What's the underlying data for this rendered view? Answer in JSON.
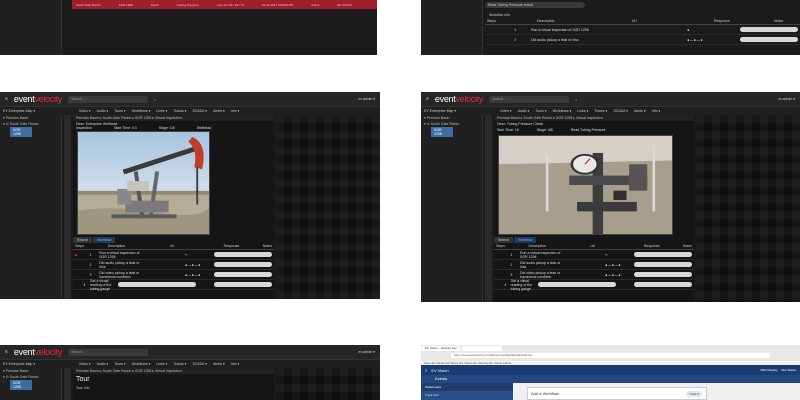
{
  "colors": {
    "brand_red": "#e8293a",
    "accent_blue": "#7ab3ff",
    "sidebar_active": "#3b6ea5",
    "table_red": "#a11e2c",
    "wv_blue": "#1a3b73"
  },
  "app": {
    "logo_event": "event",
    "logo_velocity": "velocity",
    "search": "Search...",
    "user": "ev.admin ▾"
  },
  "menu": {
    "label": "EV Enterprise Map ▾",
    "items": [
      "Video ▾",
      "Audio ▾",
      "Tours ▾",
      "Workflows ▾",
      "Links ▾",
      "Tracks ▾",
      "SCADA ▾",
      "Alerts ▾",
      "Info ▾"
    ]
  },
  "sidebar": {
    "items": [
      "▾ Permian Basin",
      "▾ ⊙ South Gate Ranch",
      "SGR 1298"
    ]
  },
  "crumb": "Permian Basin ▸ South Gate Ranch ▸ SGR 1298 ▸ Virtual Inspection",
  "p1": {
    "h1": "Desc: Enterprise Wellhead",
    "h2": "Inspection",
    "h3": "Start Time: 0:3",
    "h4": "Stage: 1/8",
    "h5": "Wellhead"
  },
  "p2": {
    "h1": "Desc: Tubing Pressure Check",
    "h2": "Start Time: 16",
    "h3": "Stage: 4/8",
    "h4": "Read Tubing Pressure"
  },
  "tabs": [
    "Search",
    "Workflow"
  ],
  "table": {
    "headers": [
      "Steps",
      "Description",
      "Url",
      "Response",
      "Notes"
    ],
    "rows": [
      [
        "1",
        "Run a virtual inspection of SGR 1298",
        "",
        "↖"
      ],
      [
        "2",
        "Did audio pickup a leak or hiss",
        "",
        "●—●—●"
      ],
      [
        "3",
        "Did video pickup a leak or hazardous condition",
        "",
        "●—●—●"
      ],
      [
        "4",
        "Get a visual reading of the tubing gauge",
        "",
        ""
      ]
    ]
  },
  "top_left": {
    "row": [
      "South Gate Ranch",
      "SGR 1298",
      "South",
      "Casing Pressure",
      "Last 1m: 93 / 92 / 11",
      "10-11-2017 3:00:59 PM",
      "Active",
      "ED-734-02"
    ]
  },
  "top_right": {
    "field": "Read Tubing Pressure check",
    "wf": "Workflow Info",
    "headers": [
      "Steps",
      "Description",
      "Url",
      "Response",
      "Notes"
    ],
    "rows": [
      [
        "1",
        "Run a virtual inspection of SGR 1298",
        "",
        "●"
      ],
      [
        "2",
        "Did audio pickup a leak or hiss",
        "",
        "●—●—●"
      ]
    ]
  },
  "p5": {
    "title": "Tour",
    "info": "Tour Info"
  },
  "p6": {
    "tab1": "EV Vision - Velocity Sec",
    "tab2": "",
    "url": "https://ev.eventvelocity.com/EnterpriseMap/Workflow/Index",
    "bookmarks": "Apps  EV Admin  EV Share  EV Vision  EV Velocity  EV Vision Admin",
    "app": "EV Vision",
    "sub": "Events",
    "left1": "Wells/Leaks",
    "left2": "Track Add",
    "mid": "Add a Workflow",
    "right1": "DEV Display",
    "right2": "Dev Status",
    "badge": "Track 5"
  }
}
